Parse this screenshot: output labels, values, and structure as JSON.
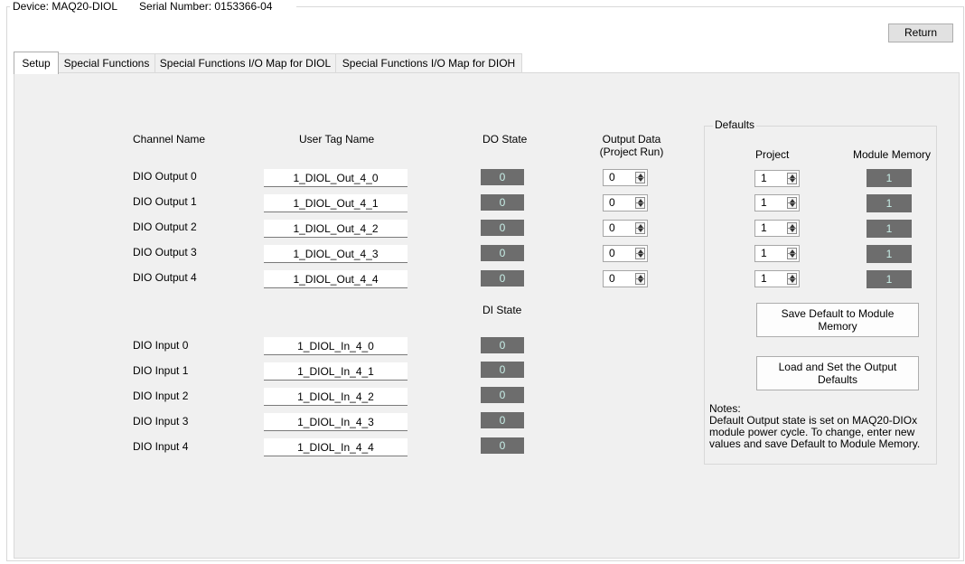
{
  "device": {
    "device_label": "Device: MAQ20-DIOL",
    "serial_label": "Serial Number: 0153366-04"
  },
  "return_button": "Return",
  "tabs": [
    {
      "label": "Setup",
      "active": true
    },
    {
      "label": "Special Functions",
      "active": false
    },
    {
      "label": "Special Functions I/O Map for DIOL",
      "active": false
    },
    {
      "label": "Special Functions I/O Map for DIOH",
      "active": false
    }
  ],
  "headers": {
    "channel_name": "Channel Name",
    "user_tag_name": "User Tag Name",
    "do_state": "DO State",
    "output_data_line1": "Output Data",
    "output_data_line2": "(Project Run)",
    "di_state": "DI State"
  },
  "outputs": [
    {
      "name": "DIO Output 0",
      "tag": "1_DIOL_Out_4_0",
      "do_state": "0",
      "output_data": "0"
    },
    {
      "name": "DIO Output 1",
      "tag": "1_DIOL_Out_4_1",
      "do_state": "0",
      "output_data": "0"
    },
    {
      "name": "DIO Output 2",
      "tag": "1_DIOL_Out_4_2",
      "do_state": "0",
      "output_data": "0"
    },
    {
      "name": "DIO Output 3",
      "tag": "1_DIOL_Out_4_3",
      "do_state": "0",
      "output_data": "0"
    },
    {
      "name": "DIO Output 4",
      "tag": "1_DIOL_Out_4_4",
      "do_state": "0",
      "output_data": "0"
    }
  ],
  "inputs": [
    {
      "name": "DIO Input 0",
      "tag": "1_DIOL_In_4_0",
      "di_state": "0"
    },
    {
      "name": "DIO Input 1",
      "tag": "1_DIOL_In_4_1",
      "di_state": "0"
    },
    {
      "name": "DIO Input 2",
      "tag": "1_DIOL_In_4_2",
      "di_state": "0"
    },
    {
      "name": "DIO Input 3",
      "tag": "1_DIOL_In_4_3",
      "di_state": "0"
    },
    {
      "name": "DIO Input 4",
      "tag": "1_DIOL_In_4_4",
      "di_state": "0"
    }
  ],
  "defaults": {
    "title": "Defaults",
    "project_header": "Project",
    "module_memory_header": "Module Memory",
    "rows": [
      {
        "project": "1",
        "module_memory": "1"
      },
      {
        "project": "1",
        "module_memory": "1"
      },
      {
        "project": "1",
        "module_memory": "1"
      },
      {
        "project": "1",
        "module_memory": "1"
      },
      {
        "project": "1",
        "module_memory": "1"
      }
    ],
    "save_button_line1": "Save Default to Module",
    "save_button_line2": "Memory",
    "load_button_line1": "Load and Set the Output",
    "load_button_line2": "Defaults",
    "notes": [
      "Notes:",
      "Default Output state is set on MAQ20-DIOx",
      "module power cycle. To change, enter new",
      "values and save Default to Module Memory."
    ]
  },
  "colors": {
    "led_background": "#6d6d6d",
    "led_text": "#c8f0e8",
    "panel_background": "#f0f0f0"
  }
}
